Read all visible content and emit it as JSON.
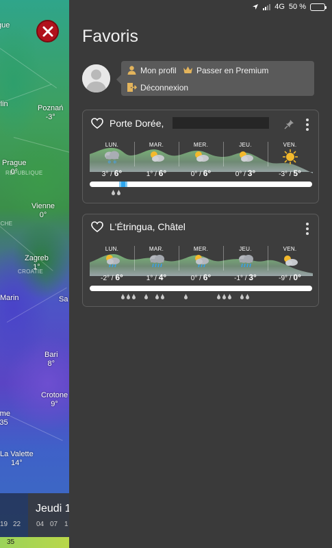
{
  "status_bar": {
    "network": "4G",
    "battery_percent": "50 %",
    "battery_level": 0.5
  },
  "map": {
    "cities": [
      {
        "name": "Poznań",
        "temp": "-3°"
      },
      {
        "name": "Prague",
        "temp": "0°"
      },
      {
        "name": "Vienne",
        "temp": "0°"
      },
      {
        "name": "Zagreb",
        "temp": "1°"
      },
      {
        "name": "Bari",
        "temp": "8°"
      },
      {
        "name": "Crotone",
        "temp": "9°"
      },
      {
        "name": "La Valette",
        "temp": "14°"
      }
    ],
    "partial_labels": [
      "gue",
      "rlin",
      "Marin",
      "Sa",
      "rme",
      "35",
      "lin"
    ],
    "countries": [
      "REPUBLIQUE",
      "CROATIE",
      "ICHE"
    ],
    "timeline": {
      "day_label": "Jeudi 1",
      "hours_left": [
        "19",
        "22"
      ],
      "hours_right": [
        "04",
        "07",
        "1"
      ]
    },
    "scale_value": "35"
  },
  "panel": {
    "title": "Favoris",
    "profile": {
      "my_profile": "Mon profil",
      "premium": "Passer en Premium",
      "logout": "Déconnexion"
    },
    "favorites": [
      {
        "name": "Porte Dorée,",
        "pinned": true,
        "days": [
          {
            "label": "LUN.",
            "icon": "snow-cloud-icon",
            "min": "3°",
            "max": "6°"
          },
          {
            "label": "MAR.",
            "icon": "partly-cloudy-icon",
            "min": "1°",
            "max": "6°"
          },
          {
            "label": "MER.",
            "icon": "partly-cloudy-icon",
            "min": "0°",
            "max": "6°"
          },
          {
            "label": "JEU.",
            "icon": "partly-cloudy-icon",
            "min": "0°",
            "max": "3°"
          },
          {
            "label": "VEN.",
            "icon": "sun-icon",
            "min": "-3°",
            "max": "5°"
          }
        ]
      },
      {
        "name": "L'Étringua, Châtel",
        "pinned": false,
        "days": [
          {
            "label": "LUN.",
            "icon": "sun-rain-cloud-icon",
            "min": "-2°",
            "max": "6°"
          },
          {
            "label": "MAR.",
            "icon": "rain-cloud-icon",
            "min": "1°",
            "max": "4°"
          },
          {
            "label": "MER.",
            "icon": "sun-rain-cloud-icon",
            "min": "0°",
            "max": "6°"
          },
          {
            "label": "JEU.",
            "icon": "rain-cloud-icon",
            "min": "-1°",
            "max": "3°"
          },
          {
            "label": "VEN.",
            "icon": "partly-cloudy-icon",
            "min": "-9°",
            "max": "0°"
          }
        ]
      }
    ]
  },
  "colors": {
    "panel_bg": "#3a3a3a",
    "card_border": "#5c5c5c",
    "precip_blue": "#2ea7ef",
    "close_red": "#b1121c",
    "mountain_green": "#6da86f"
  }
}
